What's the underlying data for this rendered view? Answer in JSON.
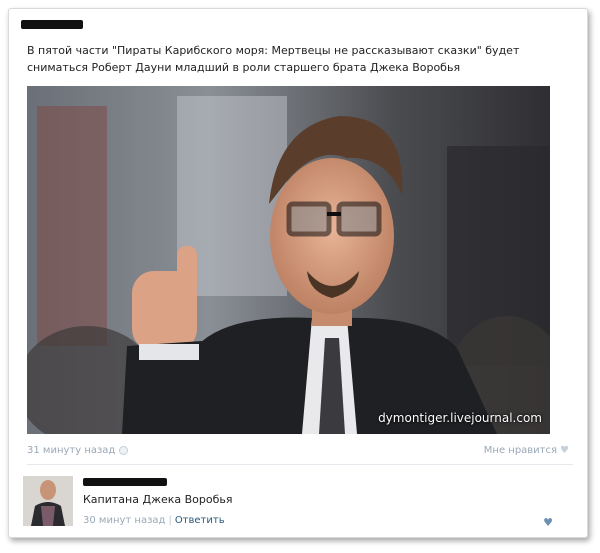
{
  "post": {
    "text": "В пятой части \"Пираты Карибского моря: Мертвецы не рассказывают сказки\" будет сниматься Роберт Дауни младший в роли старшего брата Джека Воробья",
    "image_watermark": "dymontiger.livejournal.com",
    "time": "31 минуту назад",
    "like_label": "Мне нравится"
  },
  "comment": {
    "text": "Капитана Джека Воробья",
    "time": "30 минут назад",
    "separator": "|",
    "reply_label": "Ответить"
  },
  "icons": {
    "post_time": "clock-icon",
    "like": "heart-icon",
    "comment_like": "heart-icon"
  },
  "colors": {
    "meta_text": "#9aa8b8",
    "link": "#2b587a",
    "redaction": "#111111"
  }
}
